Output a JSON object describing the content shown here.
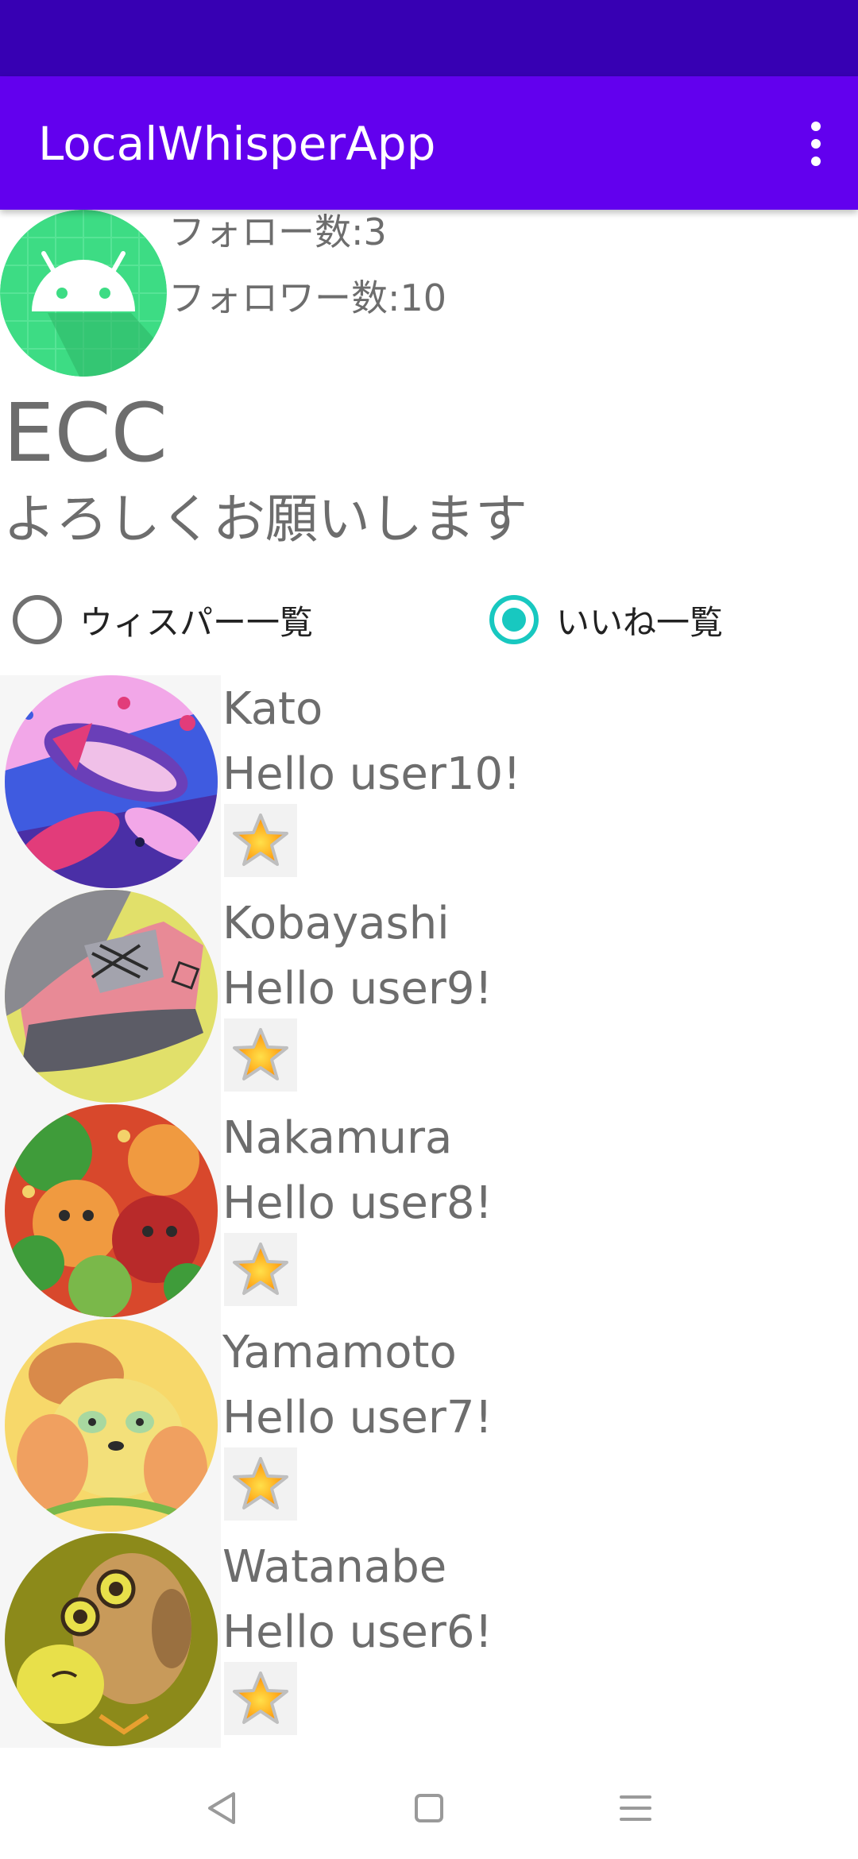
{
  "app": {
    "title": "LocalWhisperApp",
    "overflow_icon": "more-vert-icon"
  },
  "profile": {
    "avatar_icon": "android-icon",
    "follow_count": "フォロー数:3",
    "follower_count": "フォロワー数:10",
    "name": "ECC",
    "bio": "よろしくお願いします"
  },
  "list_mode": {
    "options": [
      {
        "label": "ウィスパー一覧",
        "selected": false
      },
      {
        "label": "いいね一覧",
        "selected": true
      }
    ]
  },
  "items": [
    {
      "name": "Kato",
      "message": "Hello user10!",
      "avatar": "fish-illustration",
      "liked": true
    },
    {
      "name": "Kobayashi",
      "message": "Hello user9!",
      "avatar": "shoe-illustration",
      "liked": true
    },
    {
      "name": "Nakamura",
      "message": "Hello user8!",
      "avatar": "hamsters-illustration",
      "liked": true
    },
    {
      "name": "Yamamoto",
      "message": "Hello user7!",
      "avatar": "panda-illustration",
      "liked": true
    },
    {
      "name": "Watanabe",
      "message": "Hello user6!",
      "avatar": "owls-illustration",
      "liked": true
    }
  ],
  "colors": {
    "status_bar": "#3700b3",
    "app_bar": "#6200ee",
    "radio_selected": "#18c8c0",
    "text_gray": "#6d6d6d"
  },
  "nav": {
    "back_icon": "back-triangle-icon",
    "home_icon": "home-square-icon",
    "recents_icon": "menu-lines-icon"
  }
}
